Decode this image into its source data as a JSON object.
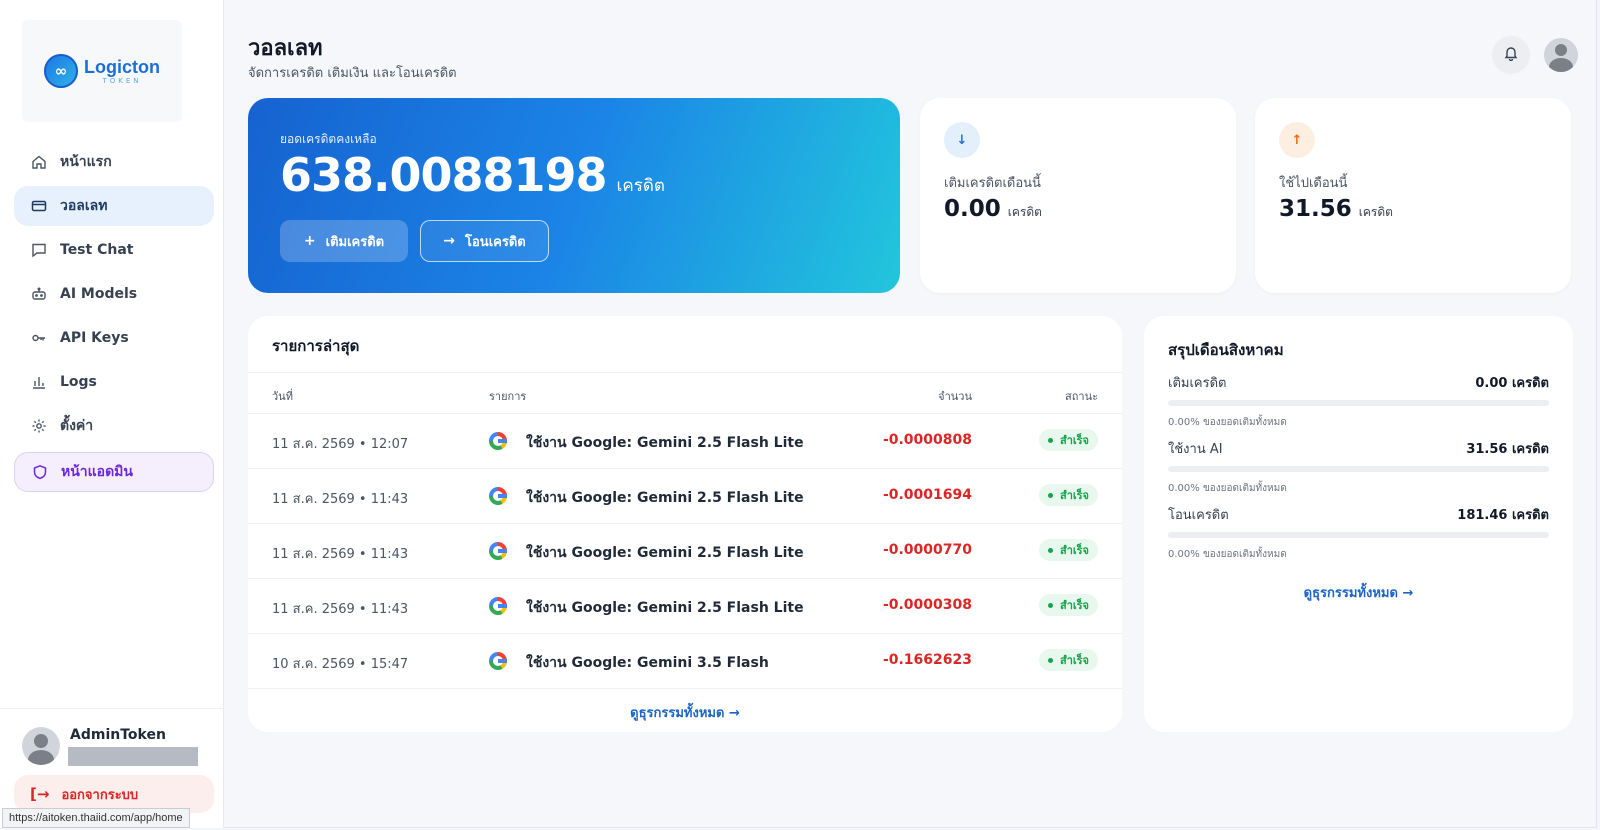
{
  "brand": {
    "name": "Logicton",
    "sub": "TOKEN",
    "mark": "∞"
  },
  "nav": {
    "home": "หน้าแรก",
    "wallet": "วอลเลท",
    "test_chat": "Test Chat",
    "ai_models": "AI Models",
    "api_keys": "API Keys",
    "logs": "Logs",
    "settings": "ตั้งค่า",
    "admin": "หน้าแอดมิน"
  },
  "user": {
    "name": "AdminToken",
    "logout": "ออกจากระบบ"
  },
  "status_url": "https://aitoken.thaiid.com/app/home",
  "header": {
    "title": "วอลเลท",
    "subtitle": "จัดการเครดิต เติมเงิน และโอนเครดิต"
  },
  "balance": {
    "label": "ยอดเครดิตคงเหลือ",
    "value": "638.0088198",
    "unit": "เครดิต",
    "topup_label": "เติมเครดิต",
    "transfer_label": "โอนเครดิต"
  },
  "stats": {
    "topup_month": {
      "label": "เติมเครดิตเดือนนี้",
      "value": "0.00",
      "unit": "เครดิต"
    },
    "spent_month": {
      "label": "ใช้ไปเดือนนี้",
      "value": "31.56",
      "unit": "เครดิต"
    }
  },
  "transactions": {
    "title": "รายการล่าสุด",
    "columns": {
      "date": "วันที่",
      "item": "รายการ",
      "amount": "จำนวน",
      "status": "สถานะ"
    },
    "rows": [
      {
        "date": "11 ส.ค. 2569 • 12:07",
        "desc": "ใช้งาน Google: Gemini 2.5 Flash Lite",
        "amount": "-0.0000808",
        "status": "สำเร็จ"
      },
      {
        "date": "11 ส.ค. 2569 • 11:43",
        "desc": "ใช้งาน Google: Gemini 2.5 Flash Lite",
        "amount": "-0.0001694",
        "status": "สำเร็จ"
      },
      {
        "date": "11 ส.ค. 2569 • 11:43",
        "desc": "ใช้งาน Google: Gemini 2.5 Flash Lite",
        "amount": "-0.0000770",
        "status": "สำเร็จ"
      },
      {
        "date": "11 ส.ค. 2569 • 11:43",
        "desc": "ใช้งาน Google: Gemini 2.5 Flash Lite",
        "amount": "-0.0000308",
        "status": "สำเร็จ"
      },
      {
        "date": "10 ส.ค. 2569 • 15:47",
        "desc": "ใช้งาน Google: Gemini 3.5 Flash",
        "amount": "-0.1662623",
        "status": "สำเร็จ"
      }
    ],
    "view_all": "ดูธุรกรรมทั้งหมด →"
  },
  "summary": {
    "title": "สรุปเดือนสิงหาคม",
    "items": [
      {
        "label": "เติมเครดิต",
        "value": "0.00 เครดิต",
        "note": "0.00% ของยอดเติมทั้งหมด",
        "percent": 0
      },
      {
        "label": "ใช้งาน AI",
        "value": "31.56 เครดิต",
        "note": "0.00% ของยอดเติมทั้งหมด",
        "percent": 0
      },
      {
        "label": "โอนเครดิต",
        "value": "181.46 เครดิต",
        "note": "0.00% ของยอดเติมทั้งหมด",
        "percent": 0
      }
    ],
    "view_all": "ดูธุรกรรมทั้งหมด →"
  },
  "colors": {
    "accent": "#1d72d8",
    "danger": "#dc2626",
    "success": "#16a34a",
    "admin": "#6d28d9"
  }
}
